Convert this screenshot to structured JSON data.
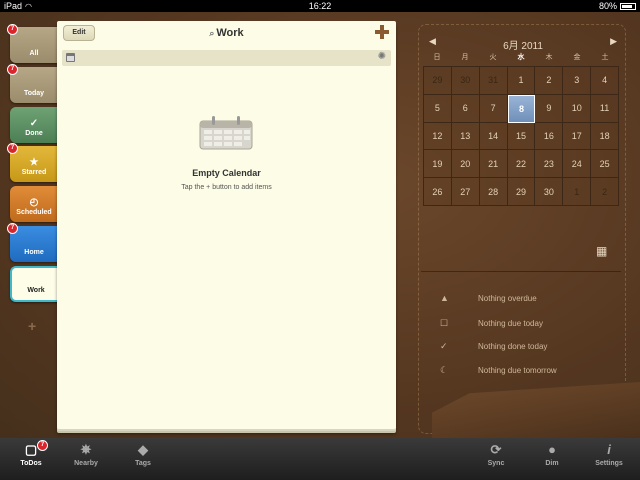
{
  "status_bar": {
    "device": "iPad",
    "time": "16:22",
    "battery": "80%"
  },
  "lists": [
    {
      "label": "All",
      "badge": "7"
    },
    {
      "label": "Today",
      "badge": "7"
    },
    {
      "label": "Done",
      "icon": "check-icon"
    },
    {
      "label": "Starred",
      "badge": "7",
      "icon": "star-icon"
    },
    {
      "label": "Scheduled",
      "icon": "clock-icon"
    },
    {
      "label": "Home",
      "badge": "7"
    },
    {
      "label": "Work"
    }
  ],
  "notepad": {
    "edit_label": "Edit",
    "title": "Work",
    "empty_title": "Empty Calendar",
    "empty_subtitle": "Tap the + button to add items"
  },
  "calendar": {
    "month_title": "6月 2011",
    "weekdays": [
      "日",
      "月",
      "火",
      "水",
      "木",
      "金",
      "土"
    ],
    "weeks": [
      [
        "29",
        "30",
        "31",
        "1",
        "2",
        "3",
        "4"
      ],
      [
        "5",
        "6",
        "7",
        "8",
        "9",
        "10",
        "11"
      ],
      [
        "12",
        "13",
        "14",
        "15",
        "16",
        "17",
        "18"
      ],
      [
        "19",
        "20",
        "21",
        "22",
        "23",
        "24",
        "25"
      ],
      [
        "26",
        "27",
        "28",
        "29",
        "30",
        "1",
        "2"
      ]
    ],
    "today": "8"
  },
  "summary": {
    "overdue": "Nothing overdue",
    "due_today": "Nothing due today",
    "done_today": "Nothing done today",
    "due_tomorrow": "Nothing due tomorrow"
  },
  "tabbar": {
    "todos": "ToDos",
    "todos_badge": "7",
    "nearby": "Nearby",
    "tags": "Tags",
    "sync": "Sync",
    "dim": "Dim",
    "settings": "Settings"
  },
  "colors": {
    "leather": "#5a3b22",
    "paper": "#fdfce6",
    "today_highlight": "#7f9cc4",
    "badge": "#d8262c"
  }
}
